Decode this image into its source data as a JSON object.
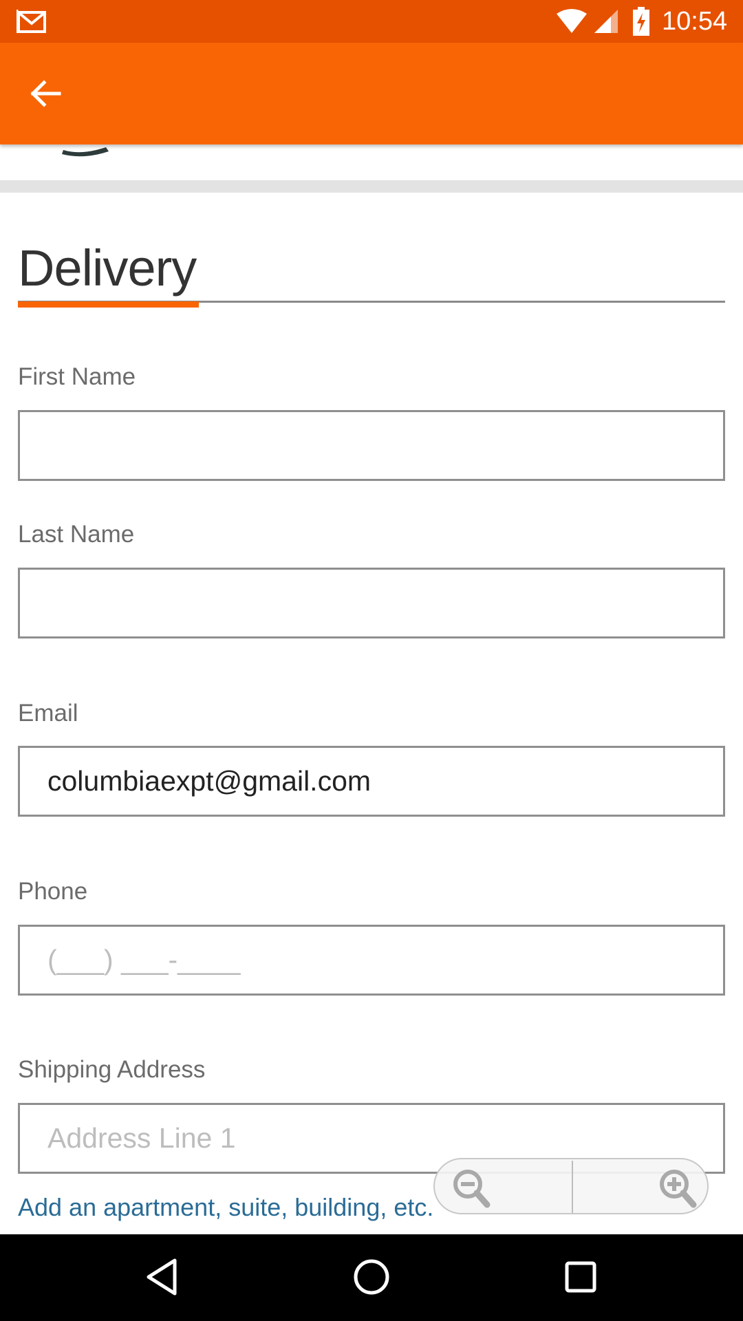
{
  "status_bar": {
    "time": "10:54",
    "icons": [
      "gmail-notification-icon",
      "wifi-icon",
      "cell-signal-icon",
      "battery-charging-icon"
    ]
  },
  "app_bar": {
    "icons": [
      "back-arrow-icon"
    ],
    "color": "#f96504"
  },
  "section": {
    "title": "Delivery",
    "accent_color": "#f96504"
  },
  "form": {
    "first_name": {
      "label": "First Name",
      "value": ""
    },
    "last_name": {
      "label": "Last Name",
      "value": ""
    },
    "email": {
      "label": "Email",
      "value": "columbiaexpt@gmail.com"
    },
    "phone": {
      "label": "Phone",
      "placeholder": "(___) ___-____"
    },
    "shipping_address": {
      "label": "Shipping Address",
      "placeholder": "Address Line 1"
    },
    "add_line_link": "Add an apartment, suite, building, etc."
  },
  "zoom_controls": {
    "icons": [
      "zoom-out-icon",
      "zoom-in-icon"
    ]
  },
  "nav_bar": {
    "icons": [
      "back-triangle-icon",
      "home-circle-icon",
      "recents-square-icon"
    ]
  }
}
